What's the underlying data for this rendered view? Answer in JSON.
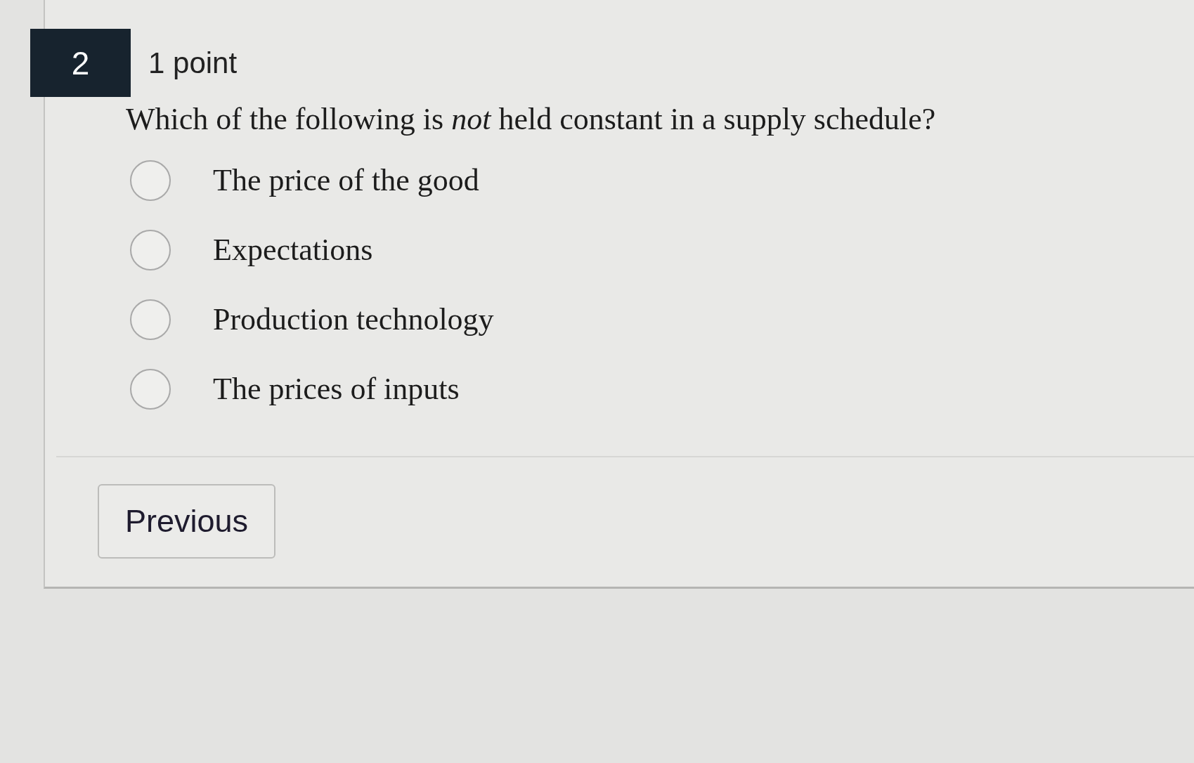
{
  "question": {
    "number": "2",
    "points": "1 point",
    "prompt": "Which of the following is *not* held constant in a supply schedule?",
    "options": [
      {
        "label": "The price of the good",
        "selected": false
      },
      {
        "label": "Expectations",
        "selected": false
      },
      {
        "label": "Production technology",
        "selected": false
      },
      {
        "label": "The prices of inputs",
        "selected": false
      }
    ]
  },
  "buttons": [
    {
      "label": "Previous"
    }
  ]
}
